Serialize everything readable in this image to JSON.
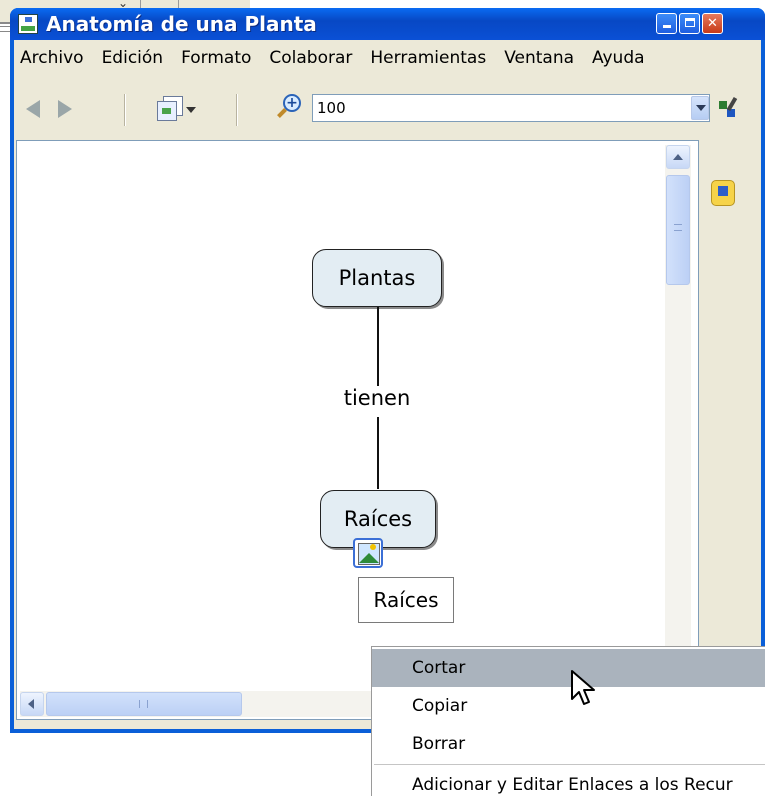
{
  "window": {
    "title": "Anatomía de una Planta",
    "controls": {
      "minimize": "minimize",
      "maximize": "maximize",
      "close": "close"
    }
  },
  "menubar": {
    "items": [
      "Archivo",
      "Edición",
      "Formato",
      "Colaborar",
      "Herramientas",
      "Ventana",
      "Ayuda"
    ]
  },
  "toolbar": {
    "icons": [
      "back-arrow-icon",
      "forward-arrow-icon",
      "view-page-icon",
      "zoom-in-icon",
      "map-tools-icon"
    ],
    "zoom_value": "100"
  },
  "concept_map": {
    "nodes": [
      {
        "id": "plantas",
        "label": "Plantas"
      },
      {
        "id": "raices",
        "label": "Raíces"
      }
    ],
    "links": [
      {
        "from": "plantas",
        "to": "raices",
        "label": "tienen"
      }
    ],
    "resource_tooltip": "Raíces"
  },
  "context_menu": {
    "items": [
      {
        "label": "Cortar",
        "selected": true
      },
      {
        "label": "Copiar",
        "selected": false
      },
      {
        "label": "Borrar",
        "selected": false
      },
      {
        "label": "Adicionar y Editar Enlaces a los Recur",
        "selected": false
      }
    ]
  },
  "colors": {
    "titlebar": "#0a5fd8",
    "window_bg": "#ece9d8",
    "node_fill": "#e3edf3",
    "menu_selected": "#aab3bd"
  }
}
